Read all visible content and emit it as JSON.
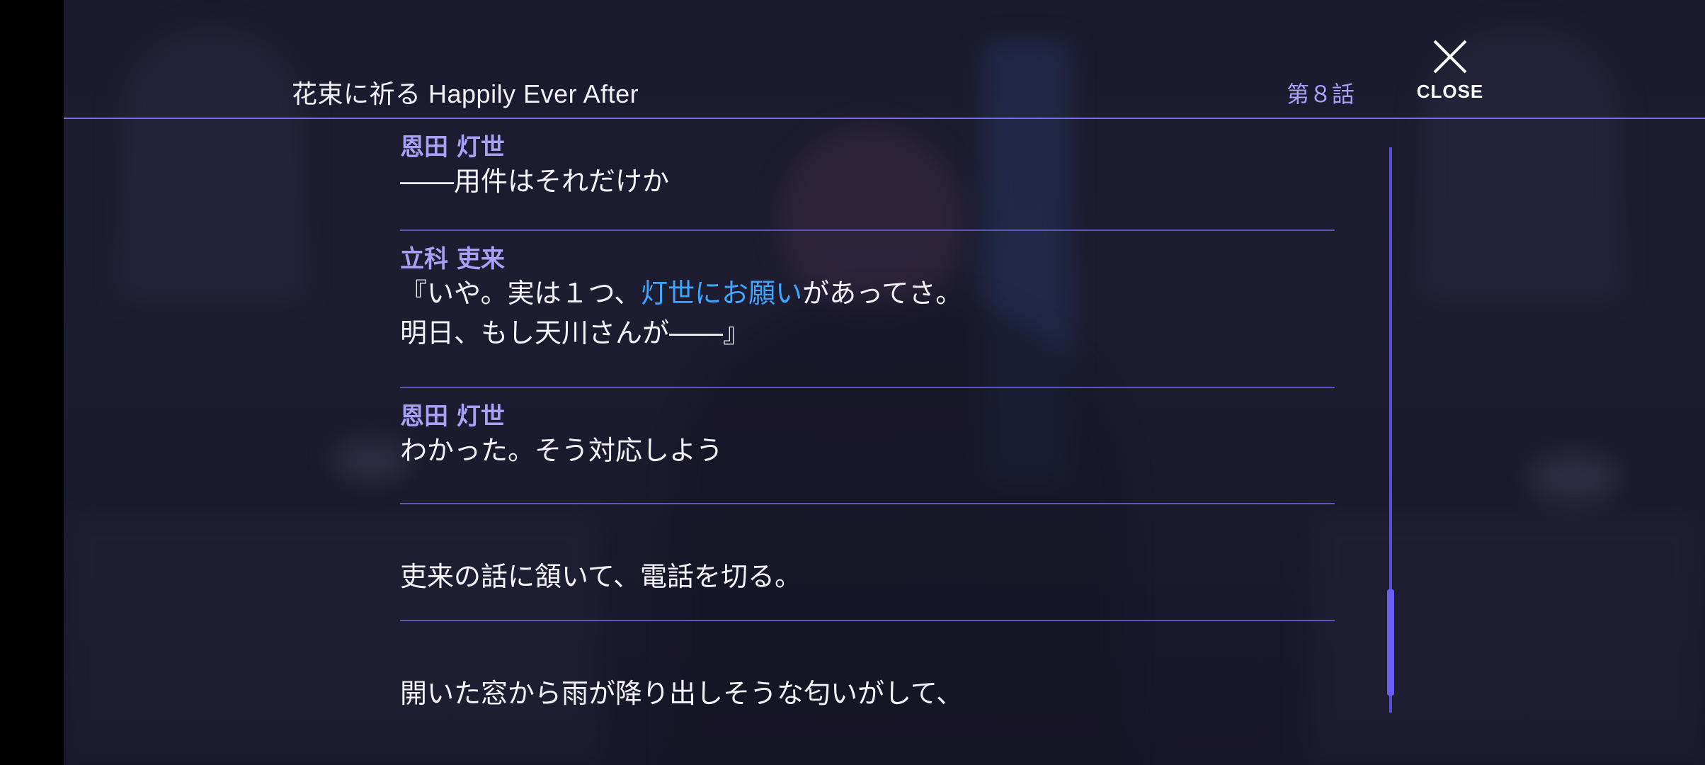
{
  "header": {
    "title": "花束に祈る Happily Ever After",
    "episode": "第８話",
    "close_label": "CLOSE"
  },
  "log": [
    {
      "speaker": "恩田 灯世",
      "lines": [
        "――用件はそれだけか"
      ]
    },
    {
      "speaker": "立科 吏来",
      "lines": [
        {
          "before": "『いや。実は１つ、",
          "highlight": "灯世にお願い",
          "after": "があってさ。"
        },
        "明日、もし天川さんが――』"
      ]
    },
    {
      "speaker": "恩田 灯世",
      "lines": [
        "わかった。そう対応しよう"
      ]
    },
    {
      "speaker": "",
      "lines": [
        "吏来の話に頷いて、電話を切る。"
      ]
    },
    {
      "speaker": "",
      "lines": [
        "開いた窓から雨が降り出しそうな匂いがして、"
      ]
    }
  ],
  "colors": {
    "accent": "#7c6de6",
    "speaker": "#a9a1f5",
    "highlight": "#3ea6ff",
    "text": "#f4f3f9"
  },
  "scroll": {
    "position_fraction": 0.9
  }
}
